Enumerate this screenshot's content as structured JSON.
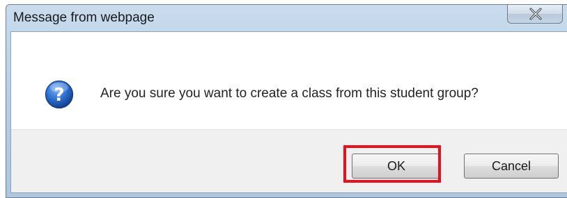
{
  "dialog": {
    "title": "Message from webpage",
    "close_icon": "close-x-icon",
    "message_icon": "question-icon",
    "message": "Are you sure you want to create a class from this student group?",
    "ok_label": "OK",
    "cancel_label": "Cancel"
  },
  "colors": {
    "highlight": "#e8101a",
    "icon_blue": "#1f5fb8"
  }
}
